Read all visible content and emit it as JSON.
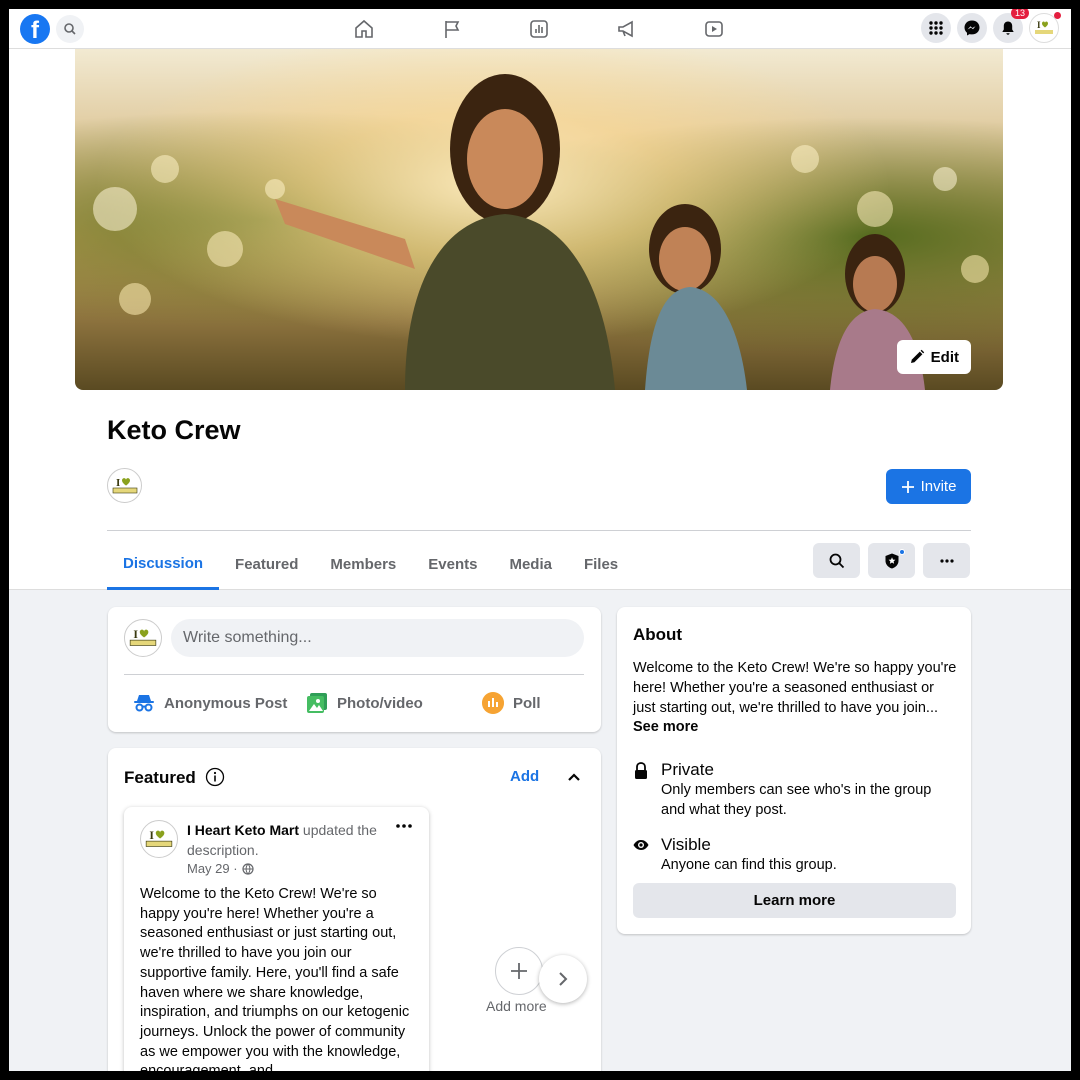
{
  "cover": {
    "edit_label": "Edit"
  },
  "group": {
    "title": "Keto Crew",
    "invite_label": "Invite"
  },
  "nav": {
    "notification_count": "13"
  },
  "tabs": [
    "Discussion",
    "Featured",
    "Members",
    "Events",
    "Media",
    "Files"
  ],
  "composer": {
    "placeholder": "Write something...",
    "actions": [
      "Anonymous Post",
      "Photo/video",
      "Poll"
    ]
  },
  "featured": {
    "title": "Featured",
    "add_label": "Add",
    "add_more_label": "Add more",
    "post": {
      "author": "I Heart Keto Mart",
      "action": " updated the description.",
      "date": "May 29 ·",
      "body": "Welcome to the Keto Crew! We're so happy you're here! Whether you're a seasoned enthusiast or just starting out, we're thrilled to have you join our supportive family. Here, you'll find a safe haven where we share knowledge, inspiration, and triumphs on our ketogenic journeys. Unlock the power of community as we empower you with the knowledge, encouragement, and"
    }
  },
  "about": {
    "title": "About",
    "description": "Welcome to the Keto Crew! We're so happy you're here! Whether you're a seasoned enthusiast or just starting out, we're thrilled to have you join...",
    "see_more": "See more",
    "private_title": "Private",
    "private_desc": "Only members can see who's in the group and what they post.",
    "visible_title": "Visible",
    "visible_desc": "Anyone can find this group.",
    "learn_more": "Learn more"
  },
  "logo_text": "I Heart Keto Mart",
  "colors": {
    "accent": "#1b74e4",
    "fb_blue": "#1877f2",
    "badge_red": "#e41e3f"
  }
}
